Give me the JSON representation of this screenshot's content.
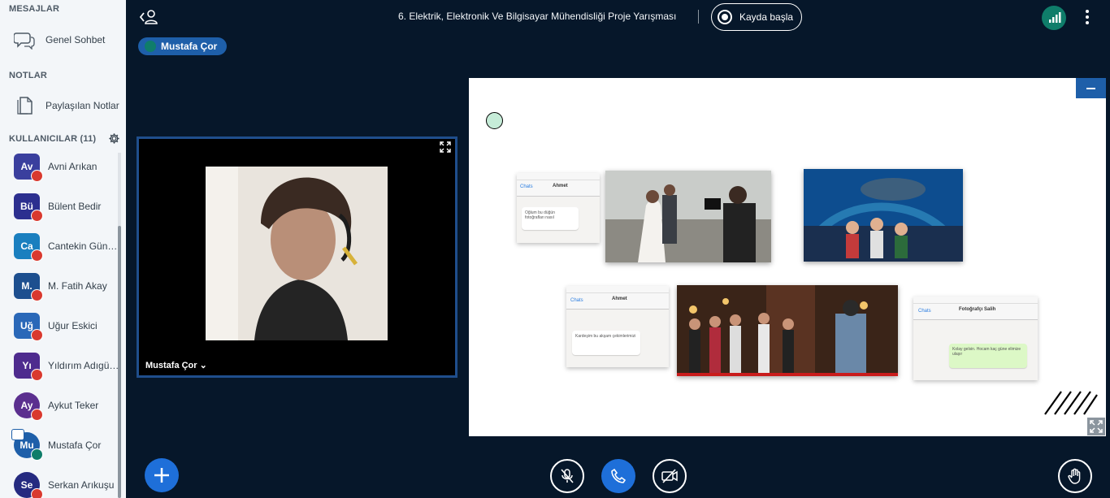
{
  "sidebar": {
    "messages_title": "MESAJLAR",
    "public_chat_label": "Genel Sohbet",
    "notes_title": "NOTLAR",
    "shared_notes_label": "Paylaşılan Notlar",
    "users_title": "KULLANICILAR (11)",
    "users": [
      {
        "initials": "Av",
        "name": "Avni Arıkan",
        "color": "#3a3f9e",
        "muted": true
      },
      {
        "initials": "Bü",
        "name": "Bülent Bedir",
        "color": "#2c2f8f",
        "muted": true
      },
      {
        "initials": "Ca",
        "name": "Cantekin Gün…",
        "color": "#1a7fbf",
        "muted": true
      },
      {
        "initials": "M.",
        "name": "M. Fatih Akay",
        "color": "#1d4f8f",
        "muted": true
      },
      {
        "initials": "Uğ",
        "name": "Uğur Eskici",
        "color": "#2a68b8",
        "muted": true
      },
      {
        "initials": "Yı",
        "name": "Yıldırım Adıgü…",
        "color": "#4e2b8e",
        "muted": true
      },
      {
        "initials": "Ay",
        "name": "Aykut Teker",
        "color": "#5b2f8f",
        "muted": true
      },
      {
        "initials": "Mu",
        "name": "Mustafa Çor",
        "color": "#1e5fa9",
        "muted": false,
        "presenter": true
      },
      {
        "initials": "Se",
        "name": "Serkan Arıkuşu",
        "color": "#252a80",
        "muted": true
      }
    ]
  },
  "topbar": {
    "title": "6. Elektrik, Elektronik Ve Bilgisayar Mühendisliği Proje Yarışması",
    "record_label": "Kayda başla"
  },
  "talking": {
    "name": "Mustafa Çor"
  },
  "webcam": {
    "name": "Mustafa Çor ⌄"
  },
  "slide": {
    "phone1": {
      "contact": "Ahmet",
      "back": "Chats",
      "message": "Oğlum bu düğün fotoğrafları nasıl"
    },
    "phone2": {
      "contact": "Ahmet",
      "back": "Chats",
      "message": "Kardeşim bu akşam çekimlerimizi"
    },
    "phone3": {
      "contact": "Fotoğrafçı Salih",
      "back": "Chats",
      "message": "Kolay gelsin. Hocam kaç güne elimize ulaşır"
    }
  },
  "colors": {
    "accent": "#1e6fd9",
    "background": "#06172a",
    "sidebar": "#f3f6f9",
    "muted_red": "#d9392f",
    "online_green": "#0f7d6a"
  }
}
